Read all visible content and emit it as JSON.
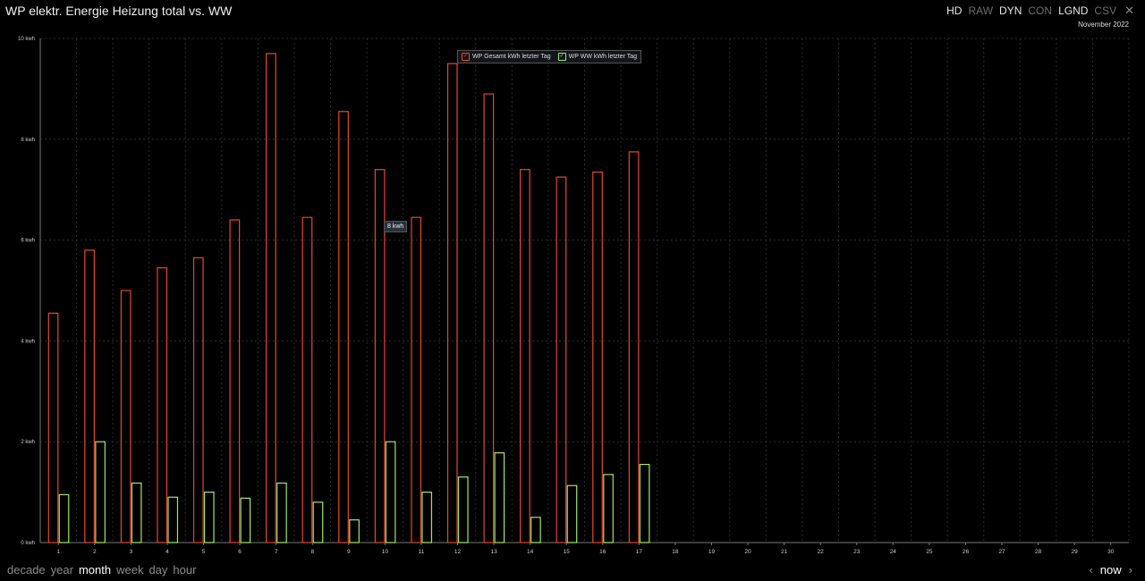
{
  "header": {
    "title": "WP elektr. Energie Heizung total vs. WW",
    "period": "November 2022",
    "toolbar": [
      {
        "label": "HD",
        "active": true
      },
      {
        "label": "RAW",
        "active": false
      },
      {
        "label": "DYN",
        "active": true
      },
      {
        "label": "CON",
        "active": false
      },
      {
        "label": "LGND",
        "active": true
      },
      {
        "label": "CSV",
        "active": false
      }
    ],
    "close_icon": "close-icon"
  },
  "legend": {
    "items": [
      "WP Gesamt kWh letzter Tag",
      "WP WW kWh letzter Tag"
    ],
    "check": "✓"
  },
  "tooltip": "8 kwh",
  "nav": {
    "ranges": [
      {
        "label": "decade",
        "active": false
      },
      {
        "label": "year",
        "active": false
      },
      {
        "label": "month",
        "active": true
      },
      {
        "label": "week",
        "active": false
      },
      {
        "label": "day",
        "active": false
      },
      {
        "label": "hour",
        "active": false
      }
    ],
    "now_label": "now",
    "prev_icon": "chevron-left-icon",
    "next_icon": "chevron-right-icon"
  },
  "colors": {
    "series1": "#e8472c",
    "series2": "#9ee86a",
    "grid": "#2a2a2a",
    "axis": "#777777"
  },
  "chart_data": {
    "type": "bar",
    "categories": [
      "1",
      "2",
      "3",
      "4",
      "5",
      "6",
      "7",
      "8",
      "9",
      "10",
      "11",
      "12",
      "13",
      "14",
      "15",
      "16",
      "17",
      "18",
      "19",
      "20",
      "21",
      "22",
      "23",
      "24",
      "25",
      "26",
      "27",
      "28",
      "29",
      "30"
    ],
    "y_ticks": [
      "0 kwh",
      "2 kwh",
      "4 kwh",
      "6 kwh",
      "8 kwh",
      "10 kwh"
    ],
    "ylim": [
      0,
      10
    ],
    "grid": true,
    "legend_position": "top-center",
    "series": [
      {
        "name": "WP Gesamt kWh letzter Tag",
        "values": [
          4.55,
          5.8,
          5.0,
          5.45,
          5.65,
          6.4,
          9.7,
          6.45,
          8.55,
          7.4,
          6.45,
          9.5,
          8.9,
          7.4,
          7.25,
          7.35,
          7.75
        ]
      },
      {
        "name": "WP WW kWh letzter Tag",
        "values": [
          0.95,
          2.0,
          1.18,
          0.9,
          1.0,
          0.88,
          1.18,
          0.8,
          0.45,
          2.0,
          1.0,
          1.3,
          1.78,
          0.5,
          1.13,
          1.35,
          1.55
        ]
      }
    ]
  }
}
